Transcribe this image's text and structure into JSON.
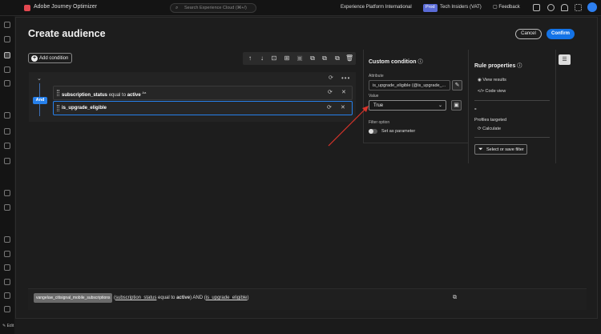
{
  "topbar": {
    "app_title": "Adobe Journey Optimizer",
    "search_placeholder": "Search Experience Cloud (⌘+/)",
    "org_name": "Experience Platform International",
    "env_badge": "Prod",
    "sandbox": "Tech Insiders (VAT)",
    "feedback": "Feedback"
  },
  "rail": {
    "edit_label": "Edit"
  },
  "modal": {
    "title": "Create audience",
    "cancel": "Cancel",
    "confirm": "Confirm"
  },
  "canvas": {
    "add_condition": "Add condition",
    "operator": "And",
    "conditions": [
      {
        "attribute": "subscription_status",
        "op": "equal to",
        "value": "active",
        "tag": "Aa"
      },
      {
        "attribute": "is_upgrade_eligible"
      }
    ]
  },
  "custom_condition": {
    "title": "Custom condition",
    "attribute_label": "Attribute",
    "attribute_value": "is_upgrade_eligible (@is_upgrade_...",
    "value_label": "Value",
    "value_selected": "True",
    "filter_option_label": "Filter option",
    "set_as_parameter": "Set as parameter"
  },
  "rule_properties": {
    "title": "Rule properties",
    "view_results": "View results",
    "code_view": "Code view",
    "count": "-",
    "profiles_targeted": "Profiles targeted",
    "calculate": "Calculate",
    "select_filter": "Select or save filter"
  },
  "footer": {
    "audience_chip": "vangeluw_citisignal_mobile_subscriptions",
    "expr_open": "(",
    "expr_attr1": "subscription_status",
    "expr_op1": " equal to ",
    "expr_val1": "active",
    "expr_mid": ") AND (",
    "expr_attr2": "is_upgrade_eligible",
    "expr_close": ")"
  },
  "colors": {
    "accent": "#2680eb",
    "confirm": "#1473e6",
    "annotation_arrow": "#d9342b"
  }
}
